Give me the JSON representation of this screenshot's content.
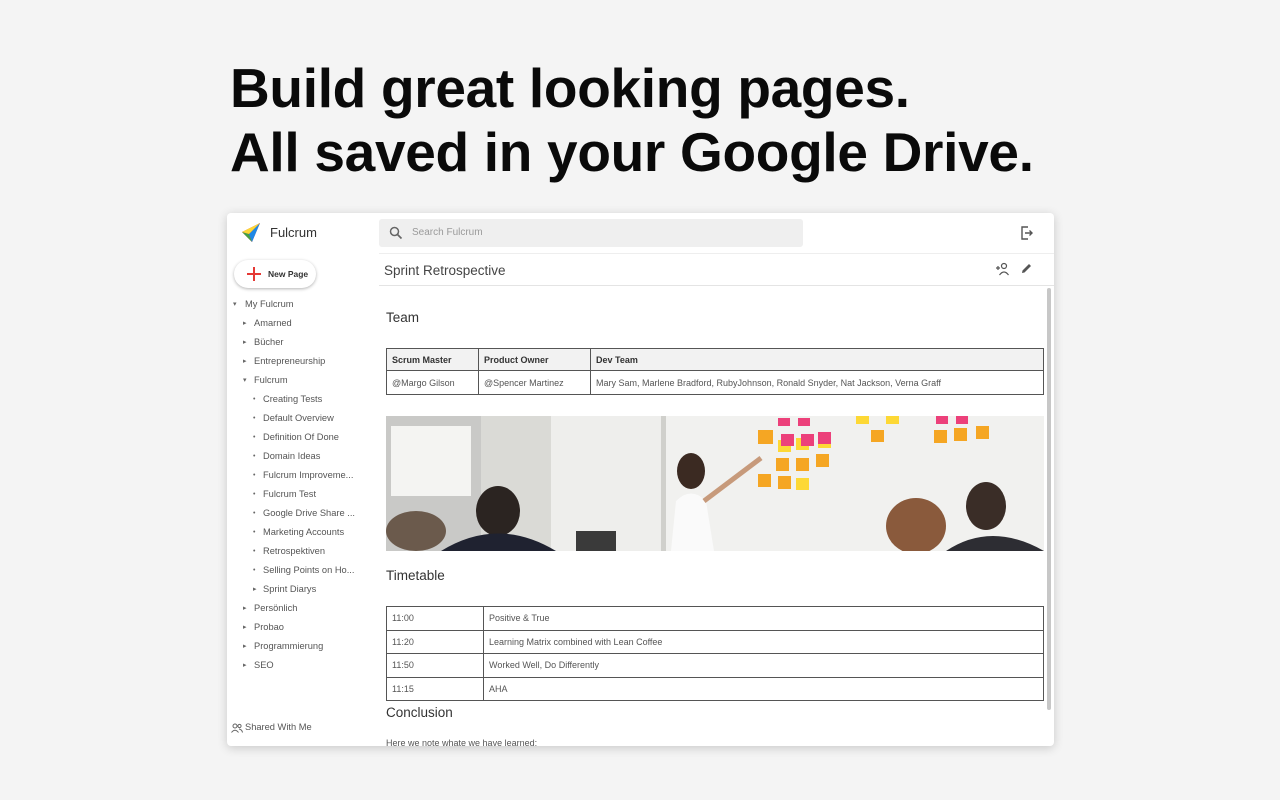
{
  "headline": {
    "line1": "Build great looking pages.",
    "line2": "All saved in your Google Drive."
  },
  "app": {
    "brand": "Fulcrum",
    "search_placeholder": "Search Fulcrum",
    "new_page_label": "New Page",
    "icons": [
      "logo",
      "search-icon",
      "logout-icon",
      "add-user-icon",
      "edit-icon"
    ]
  },
  "sidebar": {
    "root": "My Fulcrum",
    "items": [
      {
        "label": "Amarned",
        "level": 1,
        "marker": "▸"
      },
      {
        "label": "Bücher",
        "level": 1,
        "marker": "▸"
      },
      {
        "label": "Entrepreneurship",
        "level": 1,
        "marker": "▸"
      },
      {
        "label": "Fulcrum",
        "level": 1,
        "marker": "▾"
      },
      {
        "label": "Creating Tests",
        "level": 2,
        "marker": "•"
      },
      {
        "label": "Default Overview",
        "level": 2,
        "marker": "•"
      },
      {
        "label": "Definition Of Done",
        "level": 2,
        "marker": "•"
      },
      {
        "label": "Domain Ideas",
        "level": 2,
        "marker": "•"
      },
      {
        "label": "Fulcrum Improveme...",
        "level": 2,
        "marker": "•"
      },
      {
        "label": "Fulcrum Test",
        "level": 2,
        "marker": "•"
      },
      {
        "label": "Google Drive Share ...",
        "level": 2,
        "marker": "•"
      },
      {
        "label": "Marketing Accounts",
        "level": 2,
        "marker": "•"
      },
      {
        "label": "Retrospektiven",
        "level": 2,
        "marker": "•"
      },
      {
        "label": "Selling Points on Ho...",
        "level": 2,
        "marker": "•"
      },
      {
        "label": "Sprint Diarys",
        "level": 2,
        "marker": "▸"
      },
      {
        "label": "Persönlich",
        "level": 1,
        "marker": "▸"
      },
      {
        "label": "Probao",
        "level": 1,
        "marker": "▸"
      },
      {
        "label": "Programmierung",
        "level": 1,
        "marker": "▸"
      },
      {
        "label": "SEO",
        "level": 1,
        "marker": "▸"
      }
    ],
    "shared": "Shared With Me"
  },
  "page": {
    "title": "Sprint Retrospective",
    "team_heading": "Team",
    "team_table": {
      "headers": [
        "Scrum Master",
        "Product Owner",
        "Dev Team"
      ],
      "row": [
        "@Margo Gilson",
        "@Spencer Martinez",
        "Mary Sam, Marlene Bradford, RubyJohnson, Ronald Snyder, Nat Jackson, Verna Graff"
      ]
    },
    "timetable_heading": "Timetable",
    "timetable": [
      [
        "11:00",
        "Positive & True"
      ],
      [
        "11:20",
        "Learning Matrix combined with Lean Coffee"
      ],
      [
        "11:50",
        "Worked Well, Do Differently"
      ],
      [
        "11:15",
        "AHA"
      ]
    ],
    "conclusion_heading": "Conclusion",
    "conclusion_text": "Here we note whate we have learned:"
  }
}
